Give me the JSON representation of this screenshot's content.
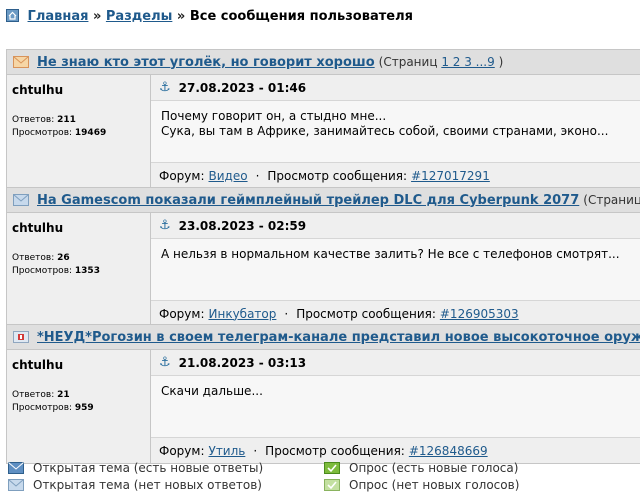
{
  "breadcrumb": {
    "home": "Главная",
    "sep1": "»",
    "sections": "Разделы",
    "sep2": "»",
    "current": "Все сообщения пользователя"
  },
  "posts": [
    {
      "topic": "Не знаю кто этот уголёк, но говорит хорошо",
      "pages_prefix": "(Страниц",
      "pages_links": "1 2 3 ...9",
      "pages_suffix": ")",
      "author": "chtulhu",
      "replies_label": "Ответов:",
      "replies": "211",
      "views_label": "Просмотров:",
      "views": "19469",
      "date": "27.08.2023 - 01:46",
      "lines": [
        "Почему говорит он, а стыдно мне...",
        "Сука, вы там в Африке, занимайтесь собой, своими странами, эконо..."
      ],
      "forum_label": "Форум:",
      "forum": "Видео",
      "dot": "·",
      "view_label": "Просмотр сообщения:",
      "msg_id": "#127017291",
      "icon": "envelope-new-icon"
    },
    {
      "topic": "На Gamescom показали геймплейный трейлер DLC для Cyberpunk 2077",
      "pages_prefix": "(Страниц",
      "pages_links": "1 2",
      "pages_suffix": ")",
      "author": "chtulhu",
      "replies_label": "Ответов:",
      "replies": "26",
      "views_label": "Просмотров:",
      "views": "1353",
      "date": "23.08.2023 - 02:59",
      "lines": [
        "А нельзя в нормальном качестве залить? Не все с телефонов смотрят..."
      ],
      "forum_label": "Форум:",
      "forum": "Инкубатор",
      "dot": "·",
      "view_label": "Просмотр сообщения:",
      "msg_id": "#126905303",
      "icon": "envelope-icon"
    },
    {
      "topic": "*НЕУД*Рогозин в своем телеграм-канале представил новое высокоточное оружие",
      "pages_prefix": "",
      "pages_links": "",
      "pages_suffix": "",
      "author": "chtulhu",
      "replies_label": "Ответов:",
      "replies": "21",
      "views_label": "Просмотров:",
      "views": "959",
      "date": "21.08.2023 - 03:13",
      "lines": [
        "Скачи дальше..."
      ],
      "forum_label": "Форум:",
      "forum": "Утиль",
      "dot": "·",
      "view_label": "Просмотр сообщения:",
      "msg_id": "#126848669",
      "icon": "closed-topic-icon"
    }
  ],
  "legend": {
    "open_new": "Открытая тема (есть новые ответы)",
    "open_nonew": "Открытая тема (нет новых ответов)",
    "poll_new": "Опрос (есть новые голоса)",
    "poll_nonew": "Опрос (нет новых голосов)"
  },
  "colors": {
    "link": "#1f5a8c",
    "header_bg": "#dfdfdf",
    "card_bg": "#efefef",
    "border": "#c6c6c6"
  }
}
